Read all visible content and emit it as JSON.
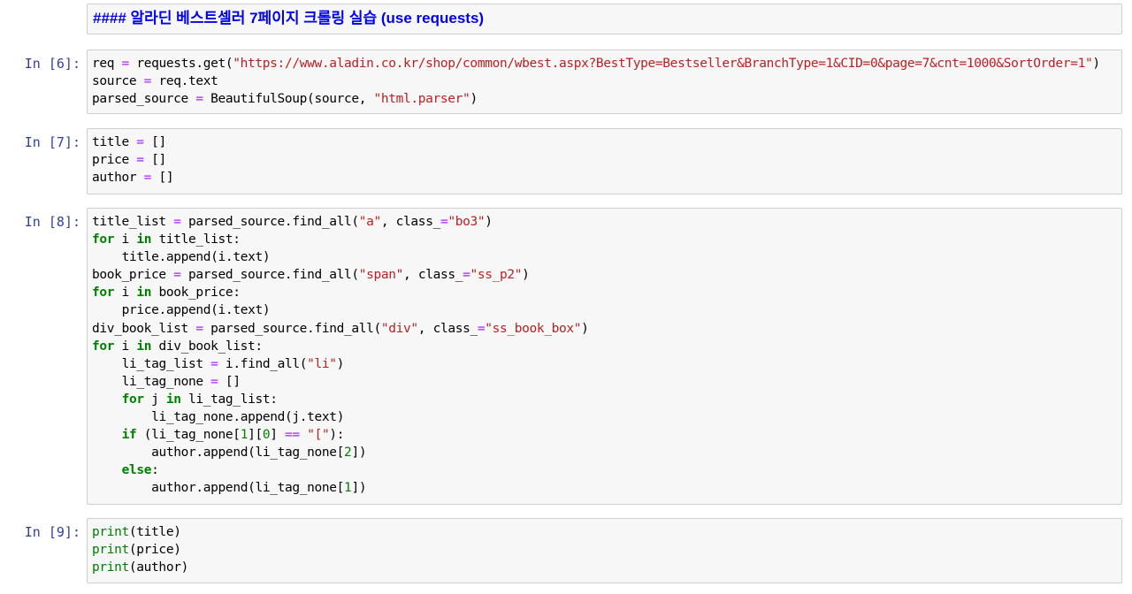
{
  "markdown_cell": {
    "text": "#### 알라딘 베스트셀러 7페이지 크롤링 실습 (use requests)"
  },
  "cells": [
    {
      "prompt": "In [6]:",
      "lines": [
        "req = requests.get(\"https://www.aladin.co.kr/shop/common/wbest.aspx?BestType=Bestseller&BranchType=1&CID=0&page=7&cnt=1000&SortOrder=1\")",
        "source = req.text",
        "parsed_source = BeautifulSoup(source, \"html.parser\")"
      ]
    },
    {
      "prompt": "In [7]:",
      "lines": [
        "title = []",
        "price = []",
        "author = []"
      ]
    },
    {
      "prompt": "In [8]:",
      "lines": [
        "title_list = parsed_source.find_all(\"a\", class_=\"bo3\")",
        "for i in title_list:",
        "    title.append(i.text)",
        "book_price = parsed_source.find_all(\"span\", class_=\"ss_p2\")",
        "for i in book_price:",
        "    price.append(i.text)",
        "div_book_list = parsed_source.find_all(\"div\", class_=\"ss_book_box\")",
        "for i in div_book_list:",
        "    li_tag_list = i.find_all(\"li\")",
        "    li_tag_none = []",
        "    for j in li_tag_list:",
        "        li_tag_none.append(j.text)",
        "    if (li_tag_none[1][0] == \"[\"):",
        "        author.append(li_tag_none[2])",
        "    else:",
        "        author.append(li_tag_none[1])"
      ]
    },
    {
      "prompt": "In [9]:",
      "lines": [
        "print(title)",
        "print(price)",
        "print(author)"
      ]
    }
  ],
  "colors": {
    "prompt": "#303f9f",
    "keyword": "#008000",
    "operator": "#aa22ff",
    "string": "#ba2121",
    "markdown_heading": "#0000ee",
    "cell_background": "#f7f7f7",
    "cell_border": "#cfcfcf"
  }
}
